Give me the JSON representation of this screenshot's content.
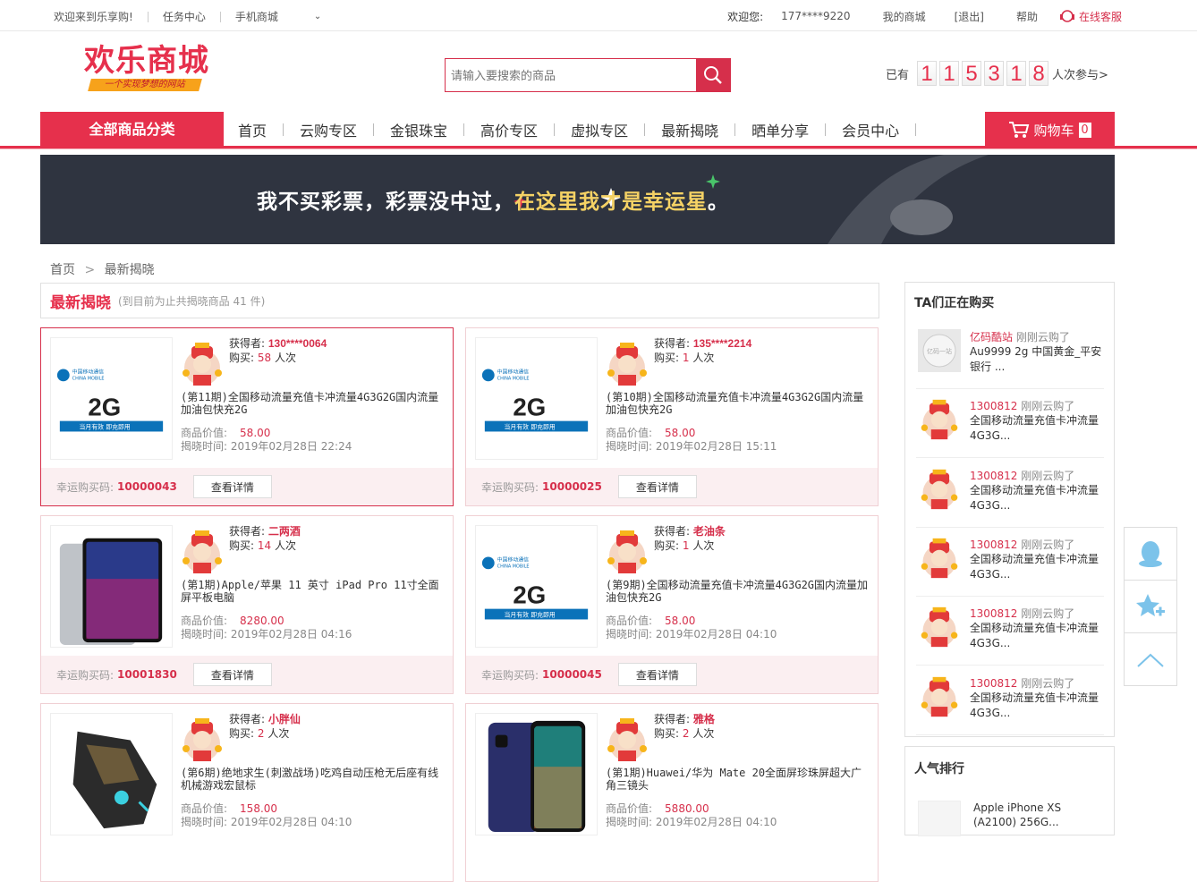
{
  "topbar": {
    "welcome": "欢迎来到乐享购!",
    "task_center": "任务中心",
    "mobile_mall": "手机商城",
    "hello": "欢迎您:",
    "user": "177****9220",
    "my_mall": "我的商城",
    "logout": "[退出]",
    "help": "帮助",
    "service": "在线客服"
  },
  "logo": {
    "title": "欢乐商城",
    "slogan": "一个实现梦想的网站"
  },
  "search": {
    "placeholder": "请输入要搜索的商品"
  },
  "counter": {
    "prefix": "已有",
    "digits": [
      "1",
      "1",
      "5",
      "3",
      "1",
      "8"
    ],
    "suffix": "人次参与>"
  },
  "nav": {
    "all_categories": "全部商品分类",
    "items": [
      "首页",
      "云购专区",
      "金银珠宝",
      "高价专区",
      "虚拟专区",
      "最新揭晓",
      "晒单分享",
      "会员中心"
    ],
    "cart_label": "购物车",
    "cart_count": "0"
  },
  "banner": {
    "text1": "我不买彩票，彩票没中过，",
    "text2": "在这里我才是幸运星",
    "text3": "。"
  },
  "breadcrumb": {
    "home": "首页",
    "current": "最新揭晓"
  },
  "latest": {
    "title": "最新揭晓",
    "subtitle": "(到目前为止共揭晓商品 41 件)"
  },
  "labels": {
    "winner": "获得者:",
    "bought": "购买:",
    "times": "人次",
    "price": "商品价值:",
    "time": "揭晓时间:",
    "lucky": "幸运购买码:",
    "detail": "查看详情"
  },
  "cards": [
    {
      "winner": "130****0064",
      "bought": "58",
      "title": "(第11期)全国移动流量充值卡冲流量4G3G2G国内流量加油包快充2G",
      "price": "58.00",
      "time": "2019年02月28日 22:24",
      "code": "10000043",
      "image": "china-mobile-2g"
    },
    {
      "winner": "135****2214",
      "bought": "1",
      "title": "(第10期)全国移动流量充值卡冲流量4G3G2G国内流量加油包快充2G",
      "price": "58.00",
      "time": "2019年02月28日 15:11",
      "code": "10000025",
      "image": "china-mobile-2g"
    },
    {
      "winner": "二两酒",
      "bought": "14",
      "title": "(第1期)Apple/苹果 11 英寸 iPad Pro 11寸全面屏平板电脑",
      "price": "8280.00",
      "time": "2019年02月28日 04:16",
      "code": "10001830",
      "image": "ipad"
    },
    {
      "winner": "老油条",
      "bought": "1",
      "title": "(第9期)全国移动流量充值卡冲流量4G3G2G国内流量加油包快充2G",
      "price": "58.00",
      "time": "2019年02月28日 04:10",
      "code": "10000045",
      "image": "china-mobile-2g"
    },
    {
      "winner": "小胖仙",
      "bought": "2",
      "title": "(第6期)绝地求生(刺激战场)吃鸡自动压枪无后座有线机械游戏宏鼠标",
      "price": "158.00",
      "time": "2019年02月28日 04:10",
      "code": "",
      "image": "mouse"
    },
    {
      "winner": "雅格",
      "bought": "2",
      "title": "(第1期)Huawei/华为 Mate 20全面屏珍珠屏超大广角三镜头",
      "price": "5880.00",
      "time": "2019年02月28日 04:10",
      "code": "",
      "image": "phone"
    }
  ],
  "sidebar": {
    "title": "TA们正在购买",
    "action": "刚刚云购了",
    "items": [
      {
        "user": "亿码酷站",
        "product": "Au9999 2g 中国黄金_平安银行 ..."
      },
      {
        "user": "1300812",
        "product": "全国移动流量充值卡冲流量4G3G..."
      },
      {
        "user": "1300812",
        "product": "全国移动流量充值卡冲流量4G3G..."
      },
      {
        "user": "1300812",
        "product": "全国移动流量充值卡冲流量4G3G..."
      },
      {
        "user": "1300812",
        "product": "全国移动流量充值卡冲流量4G3G..."
      },
      {
        "user": "1300812",
        "product": "全国移动流量充值卡冲流量4G3G..."
      }
    ]
  },
  "popular": {
    "title": "人气排行",
    "item1": "Apple iPhone XS",
    "item1b": "(A2100) 256G..."
  },
  "colors": {
    "brand": "#e6304c",
    "banner_bg": "#2f3440"
  }
}
